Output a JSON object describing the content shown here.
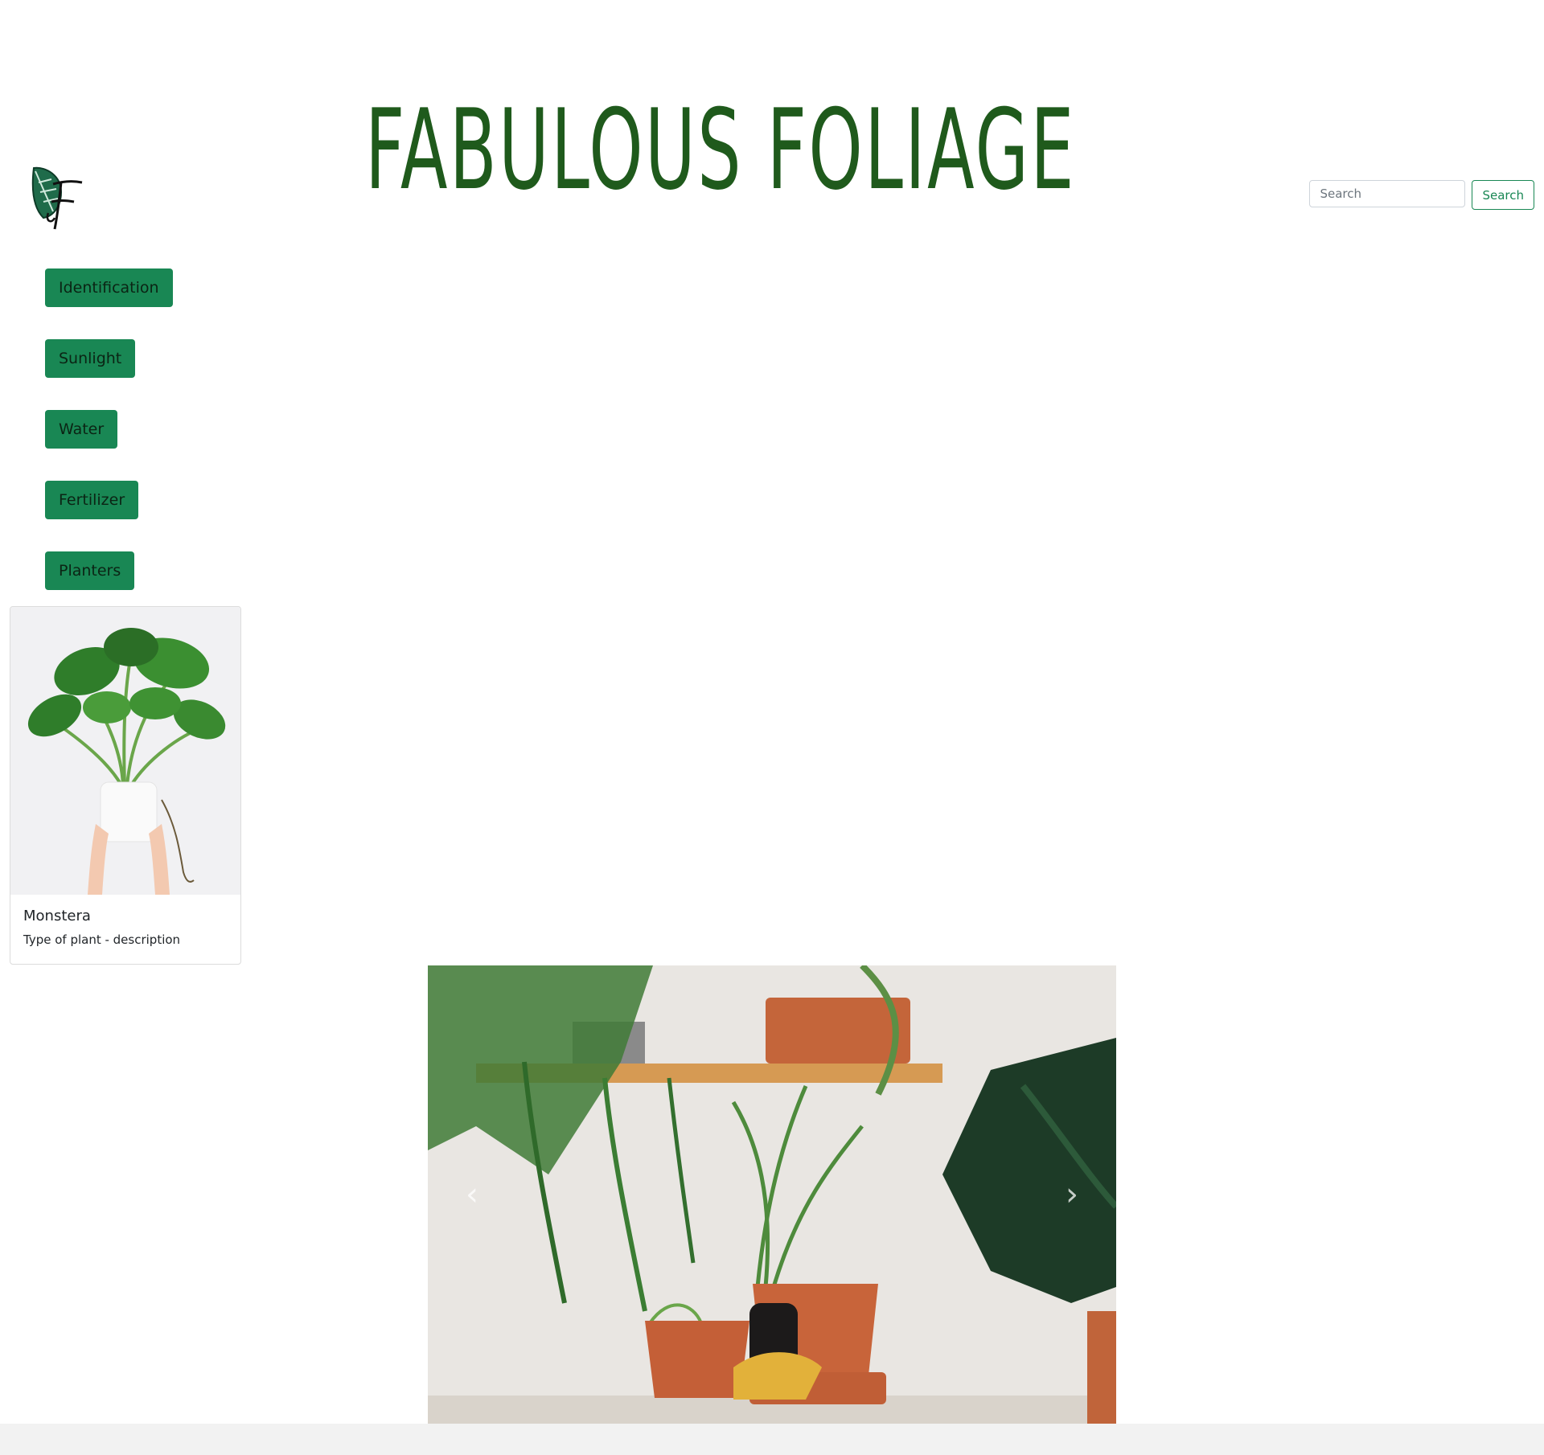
{
  "site": {
    "title": "FABULOUS FOLIAGE",
    "logo_icon": "leaf-monogram-icon",
    "brand_green": "#198754",
    "title_green": "#1f5a1c"
  },
  "search": {
    "placeholder": "Search",
    "button_label": "Search"
  },
  "nav": {
    "items": [
      {
        "label": "Identification"
      },
      {
        "label": "Sunlight"
      },
      {
        "label": "Water"
      },
      {
        "label": "Fertilizer"
      },
      {
        "label": "Planters"
      }
    ]
  },
  "card": {
    "title": "Monstera",
    "text": "Type of plant - description"
  },
  "carousel": {
    "prev_icon": "chevron-left-icon",
    "next_icon": "chevron-right-icon",
    "prev_glyph": "‹",
    "next_glyph": "›"
  }
}
